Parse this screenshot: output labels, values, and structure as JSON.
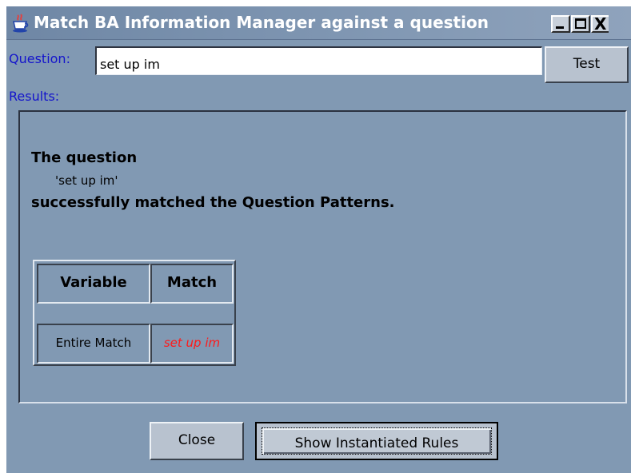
{
  "window": {
    "title": "Match BA Information Manager against a question",
    "icons": {
      "app": "java-coffee-cup-icon",
      "minimize": "minimize-icon",
      "maximize": "maximize-icon",
      "close": "close-icon"
    },
    "close_glyph": "X"
  },
  "question": {
    "label": "Question:",
    "value": "set up im",
    "test_label": "Test"
  },
  "results": {
    "label": "Results:",
    "heading": "The question",
    "quoted_question": "'set up im'",
    "message": "successfully matched the Question Patterns.",
    "table": {
      "headers": [
        "Variable",
        "Match"
      ],
      "rows": [
        [
          "Entire Match",
          "set up im"
        ]
      ]
    }
  },
  "footer": {
    "close_label": "Close",
    "show_rules_label": "Show Instantiated Rules"
  },
  "colors": {
    "window_bg": "#8199b3",
    "label_blue": "#1414cc",
    "match_red": "#ff1a1a"
  }
}
